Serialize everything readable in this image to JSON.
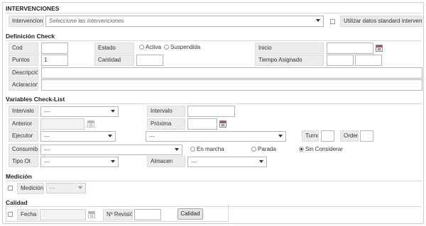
{
  "intervenciones": {
    "title": "INTERVENCIONES",
    "label": "Intervenciones",
    "placeholder": "Seleccione las intervenciones",
    "standard_label": "Utilizar datos standard intervencion"
  },
  "definicion": {
    "title": "Definición Check",
    "cod_label": "Cod",
    "cod_value": "",
    "estado_label": "Estado",
    "estado_options": [
      "Activa",
      "Suspendida"
    ],
    "inicio_label": "Inicio",
    "puntos_label": "Puntos",
    "puntos_value": "1",
    "cantidad_label": "Cantidad",
    "tiempo_label": "Tiempo Asignado",
    "descripcion_label": "Descripción",
    "aclaraciones_label": "Aclaraciones"
  },
  "variables": {
    "title": "Variables Check-List",
    "intervalo_label": "Intervalo",
    "intervalo_value": "---",
    "intervalo2_label": "Intervalo",
    "anterior_label": "Anterior",
    "proxima_label": "Próxima",
    "ejecutor_label": "Ejecutor",
    "ejecutor_value": "---",
    "ejecutor2_value": "---",
    "turno_label": "Turno",
    "orden_label": "Orden",
    "consumible_label": "Consumible",
    "consumible_value": "---",
    "consumible_options": [
      "En marcha",
      "Parada",
      "Sin Considerar"
    ],
    "tipo_label": "Tipo Ot",
    "tipo_value": "---",
    "almacen_label": "Almacen",
    "almacen_value": "---"
  },
  "medicion": {
    "title": "Medición",
    "label": "Medición",
    "value": "---"
  },
  "calidad": {
    "title": "Calidad",
    "fecha_label": "Fecha",
    "revision_label": "Nº Revisión",
    "button_label": "Calidad"
  }
}
